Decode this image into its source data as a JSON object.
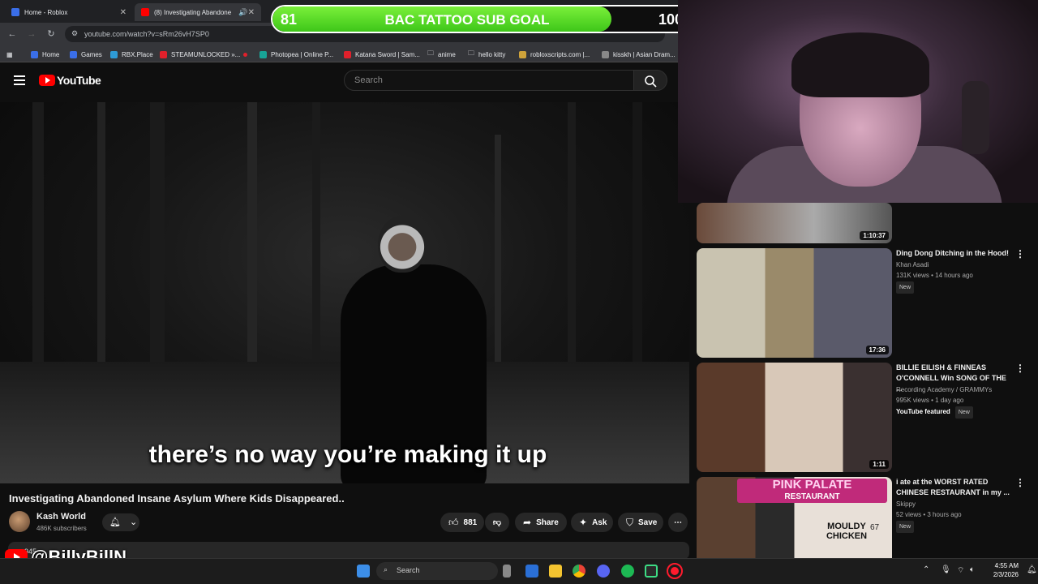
{
  "browser": {
    "tabs": [
      {
        "label": "Home - Roblox",
        "fav_color": "#3a6ee8"
      },
      {
        "label": "(8) Investigating Abandone",
        "fav_color": "#ff0000"
      }
    ],
    "url": "youtube.com/watch?v=sRm26vH7SP0",
    "bookmarks": [
      {
        "label": "Home",
        "color": "#3a6ee8"
      },
      {
        "label": "Games",
        "color": "#3a6ee8"
      },
      {
        "label": "RBX.Place",
        "color": "#2e9bd6"
      },
      {
        "label": "STEAMUNLOCKED »...",
        "color": "#e0202b"
      },
      {
        "label": "Photopea | Online P...",
        "color": "#18a497"
      },
      {
        "label": "Katana Sword | Sam...",
        "color": "#e0202b"
      },
      {
        "label": "anime",
        "color": "folder"
      },
      {
        "label": "hello kitty",
        "color": "folder"
      },
      {
        "label": "robloxscripts.com |...",
        "color": "#cfa33a"
      },
      {
        "label": "kisskh | Asian Dram...",
        "color": "#888888"
      }
    ]
  },
  "goal": {
    "current": "81",
    "title": "BAC TATTOO SUB GOAL",
    "target": "100",
    "progress": 0.81,
    "color": "#55dd22"
  },
  "youtube": {
    "logo_text": "YouTube",
    "search_placeholder": "Search"
  },
  "video": {
    "subtitle": "there’s no way you’re making it up",
    "title": "Investigating Abandoned Insane Asylum Where Kids Disappeared..",
    "channel": "Kash World",
    "subscribers": "486K subscribers",
    "likes": "881",
    "share_label": "Share",
    "ask_label": "Ask",
    "save_label": "Save",
    "views_partial": "945"
  },
  "watermark": {
    "handle": "@BillyBillN"
  },
  "recommendations": [
    {
      "title": "",
      "duration": "1:10:37",
      "channel": "",
      "meta": ""
    },
    {
      "title": "Ding Dong Ditching in the Hood!",
      "channel": "Khan Asadi",
      "meta": "131K views • 14 hours ago",
      "badge": "New",
      "duration": "17:36"
    },
    {
      "title": "BILLIE EILISH & FINNEAS O'CONNELL Win SONG OF THE ...",
      "channel": "Recording Academy / GRAMMYs",
      "meta": "995K views • 1 day ago",
      "badge": "YouTube featured",
      "badge2": "New",
      "duration": "1:11"
    },
    {
      "title": "i ate at the WORST RATED CHINESE RESTAURANT in my ...",
      "channel": "Skippy",
      "meta": "52 views • 3 hours ago",
      "badge": "New",
      "thumb_text1": "PINK PALATE",
      "thumb_text2": "RESTAURANT",
      "thumb_text3": "MOULDY CHICKEN",
      "thumb_rating": "67"
    }
  ],
  "taskbar": {
    "search_placeholder": "Search",
    "time": "4:55 AM",
    "date": "2/3/2026"
  }
}
